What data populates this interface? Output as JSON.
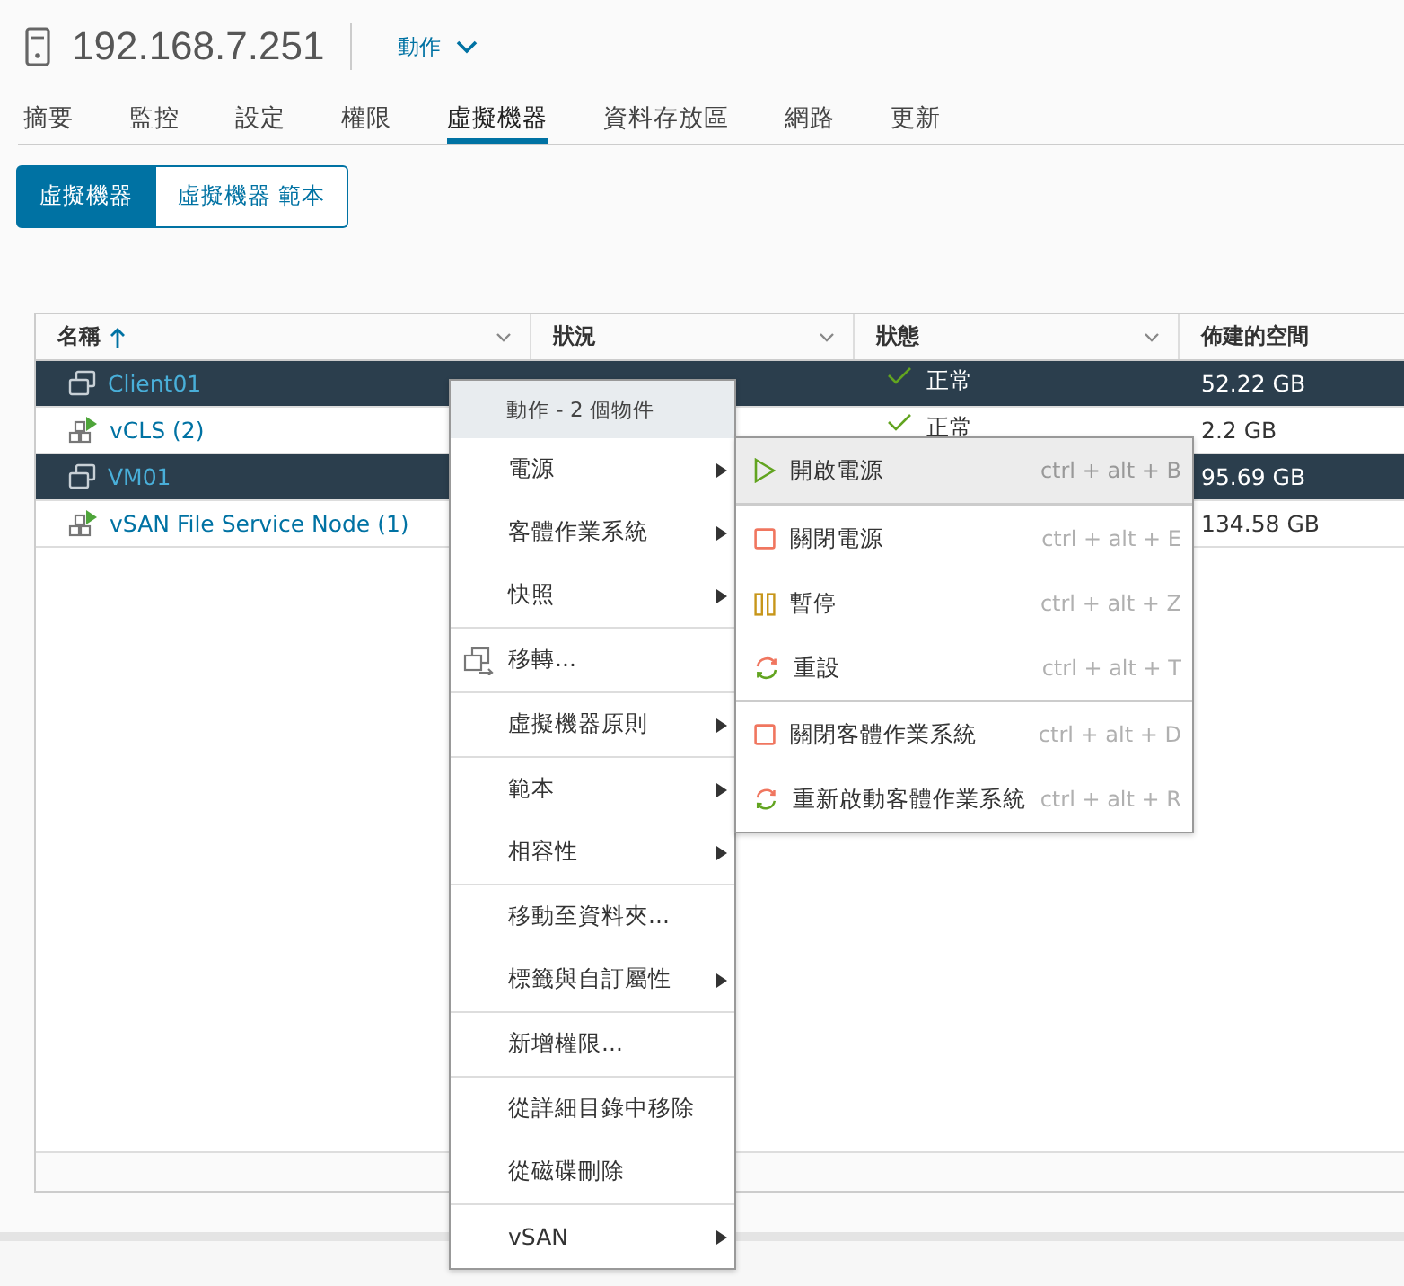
{
  "header": {
    "title": "192.168.7.251",
    "actions_label": "動作"
  },
  "tabs": [
    {
      "label": "摘要",
      "selected": false
    },
    {
      "label": "監控",
      "selected": false
    },
    {
      "label": "設定",
      "selected": false
    },
    {
      "label": "權限",
      "selected": false
    },
    {
      "label": "虛擬機器",
      "selected": true
    },
    {
      "label": "資料存放區",
      "selected": false
    },
    {
      "label": "網路",
      "selected": false
    },
    {
      "label": "更新",
      "selected": false
    }
  ],
  "view_toggle": [
    {
      "label": "虛擬機器",
      "selected": true
    },
    {
      "label": "虛擬機器 範本",
      "selected": false
    }
  ],
  "table": {
    "columns": [
      {
        "label": "名稱",
        "sorted": true,
        "menu": true
      },
      {
        "label": "狀況",
        "sorted": false,
        "menu": true
      },
      {
        "label": "狀態",
        "sorted": false,
        "menu": true
      },
      {
        "label": "佈建的空間",
        "sorted": false
      }
    ],
    "rows": [
      {
        "name": "Client01",
        "kind": "vm",
        "state": "正常",
        "space": "52.22 GB",
        "selected": true
      },
      {
        "name": "vCLS (2)",
        "kind": "group",
        "state": "正常",
        "space": "2.2 GB",
        "selected": false
      },
      {
        "name": "VM01",
        "kind": "vm",
        "space": "95.69 GB",
        "selected": true
      },
      {
        "name": "vSAN File Service Node (1)",
        "kind": "group",
        "space": "134.58 GB",
        "selected": false
      }
    ]
  },
  "context_menu": {
    "title": "動作 - 2 個物件",
    "items": [
      {
        "label": "電源",
        "submenu": true,
        "separator_before": false
      },
      {
        "label": "客體作業系統",
        "submenu": true,
        "separator_before": false
      },
      {
        "label": "快照",
        "submenu": true,
        "separator_before": false
      },
      {
        "label": "移轉...",
        "submenu": false,
        "separator_before": true,
        "kind": "migrate"
      },
      {
        "label": "虛擬機器原則",
        "submenu": true,
        "separator_before": true
      },
      {
        "label": "範本",
        "submenu": true,
        "separator_before": true
      },
      {
        "label": "相容性",
        "submenu": true,
        "separator_before": false
      },
      {
        "label": "移動至資料夾...",
        "submenu": false,
        "separator_before": true
      },
      {
        "label": "標籤與自訂屬性",
        "submenu": true,
        "separator_before": false
      },
      {
        "label": "新增權限...",
        "submenu": false,
        "separator_before": true
      },
      {
        "label": "從詳細目錄中移除",
        "submenu": false,
        "separator_before": true
      },
      {
        "label": "從磁碟刪除",
        "submenu": false,
        "separator_before": false
      },
      {
        "label": "vSAN",
        "submenu": true,
        "separator_before": true
      }
    ]
  },
  "submenu": {
    "items": [
      {
        "label": "開啟電源",
        "kind": "play",
        "shortcut": "ctrl + alt + B",
        "highlighted": true,
        "separator_before": false
      },
      {
        "label": "關閉電源",
        "kind": "stop",
        "shortcut": "ctrl + alt + E",
        "highlighted": false,
        "separator_before": true
      },
      {
        "label": "暫停",
        "kind": "pause",
        "shortcut": "ctrl + alt + Z",
        "highlighted": false,
        "separator_before": false
      },
      {
        "label": "重設",
        "kind": "reset",
        "shortcut": "ctrl + alt + T",
        "highlighted": false,
        "separator_before": false
      },
      {
        "label": "關閉客體作業系統",
        "kind": "stop",
        "shortcut": "ctrl + alt + D",
        "highlighted": false,
        "separator_before": true
      },
      {
        "label": "重新啟動客體作業系統",
        "kind": "reset",
        "shortcut": "ctrl + alt + R",
        "highlighted": false,
        "separator_before": false
      }
    ]
  }
}
